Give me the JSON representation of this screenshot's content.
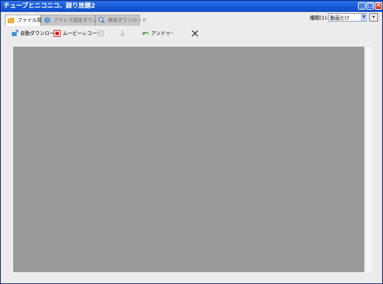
{
  "window": {
    "title": "チューブとニコニコ、録り放題2"
  },
  "tabs": [
    {
      "label": "ファイル管理",
      "icon": "folder-icon"
    },
    {
      "label": "アドレス指定ダウンロード",
      "icon": "globe-icon"
    },
    {
      "label": "検索ダウンロード",
      "icon": "magnifier-icon"
    }
  ],
  "kind": {
    "label": "種類(1):",
    "value": "動画だけ"
  },
  "toolbar": {
    "auto_download": "自動ダウンロード",
    "movie_recorder": "ムービーレコーダ",
    "btn3": "",
    "btn4": "",
    "undo": "アンドゥ",
    "redo": "",
    "delete": ""
  },
  "colors": {
    "title_bar": "#0a4bc8",
    "panel": "#999999"
  }
}
